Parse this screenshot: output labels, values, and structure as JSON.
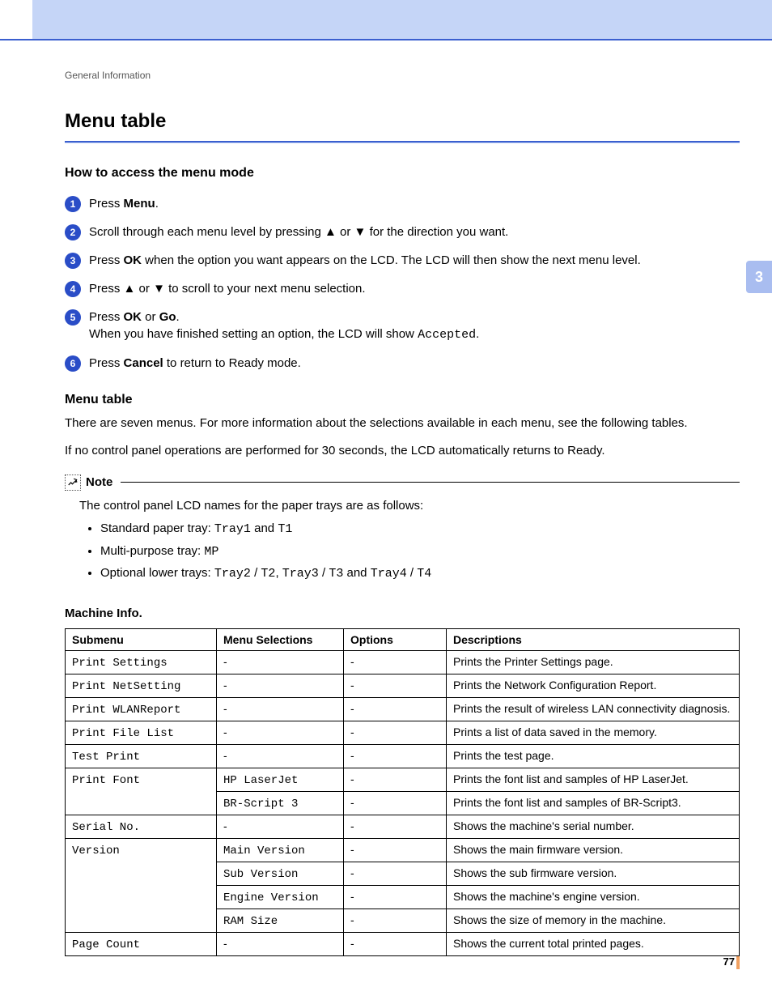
{
  "breadcrumb": "General Information",
  "chapter_tab": "3",
  "page_number": "77",
  "h1": "Menu table",
  "h2": "How to access the menu mode",
  "steps": {
    "s1_pre": "Press ",
    "s1_b": "Menu",
    "s1_post": ".",
    "s2_pre": "Scroll through each menu level by pressing ",
    "s2_mid": " or ",
    "s2_post": " for the direction you want.",
    "s3_pre": "Press ",
    "s3_b": "OK",
    "s3_post": " when the option you want appears on the LCD. The LCD will then show the next menu level.",
    "s4_pre": "Press ",
    "s4_mid": " or ",
    "s4_post": " to scroll to your next menu selection.",
    "s5_pre": "Press ",
    "s5_b1": "OK",
    "s5_mid": " or ",
    "s5_b2": "Go",
    "s5_post1": ".",
    "s5_line2_pre": "When you have finished setting an option, the LCD will show ",
    "s5_line2_code": "Accepted",
    "s5_line2_post": ".",
    "s6_pre": "Press ",
    "s6_b": "Cancel",
    "s6_post": " to return to Ready mode."
  },
  "arrows": {
    "up": "▲",
    "down": "▼"
  },
  "para_title": "Menu table",
  "para1": "There are seven menus. For more information about the selections available in each menu, see the following tables.",
  "para2": "If no control panel operations are performed for 30 seconds, the LCD automatically returns to Ready.",
  "note": {
    "label": "Note",
    "intro": "The control panel LCD names for the paper trays are as follows:",
    "b1_pre": "Standard paper tray: ",
    "b1_c1": "Tray1",
    "b1_mid": " and ",
    "b1_c2": "T1",
    "b2_pre": "Multi-purpose tray: ",
    "b2_c1": "MP",
    "b3_pre": "Optional lower trays: ",
    "b3_c1": "Tray2",
    "b3_s1": " / ",
    "b3_c2": "T2",
    "b3_s2": ", ",
    "b3_c3": "Tray3",
    "b3_s3": " / ",
    "b3_c4": "T3",
    "b3_s4": " and ",
    "b3_c5": "Tray4",
    "b3_s5": " / ",
    "b3_c6": "T4"
  },
  "table_title": "Machine Info.",
  "table": {
    "headers": {
      "c1": "Submenu",
      "c2": "Menu Selections",
      "c3": "Options",
      "c4": "Descriptions"
    },
    "rows": [
      {
        "c1": "Print Settings",
        "c2": "-",
        "c3": "-",
        "c4": "Prints the Printer Settings page."
      },
      {
        "c1": "Print NetSetting",
        "c2": "-",
        "c3": "-",
        "c4": "Prints the Network Configuration Report."
      },
      {
        "c1": "Print WLANReport",
        "c2": "-",
        "c3": "-",
        "c4": "Prints the result of wireless LAN connectivity diagnosis."
      },
      {
        "c1": "Print File List",
        "c2": "-",
        "c3": "-",
        "c4": "Prints a list of data saved in the memory."
      },
      {
        "c1": "Test Print",
        "c2": "-",
        "c3": "-",
        "c4": "Prints the test page."
      },
      {
        "c1": "Print Font",
        "c2": "HP LaserJet",
        "c3": "-",
        "c4": "Prints the font list and samples of HP LaserJet."
      },
      {
        "c1": "",
        "c2": "BR-Script 3",
        "c3": "-",
        "c4": "Prints the font list and samples of BR-Script3."
      },
      {
        "c1": "Serial No.",
        "c2": "-",
        "c3": "-",
        "c4": "Shows the machine's serial number."
      },
      {
        "c1": "Version",
        "c2": "Main Version",
        "c3": "-",
        "c4": "Shows the main firmware version."
      },
      {
        "c1": "",
        "c2": "Sub Version",
        "c3": "-",
        "c4": "Shows the sub firmware version."
      },
      {
        "c1": "",
        "c2": "Engine Version",
        "c3": "-",
        "c4": "Shows the machine's engine version."
      },
      {
        "c1": "",
        "c2": "RAM Size",
        "c3": "-",
        "c4": "Shows the size of memory in the machine."
      },
      {
        "c1": "Page Count",
        "c2": "-",
        "c3": "-",
        "c4": "Shows the current total printed pages."
      }
    ]
  }
}
